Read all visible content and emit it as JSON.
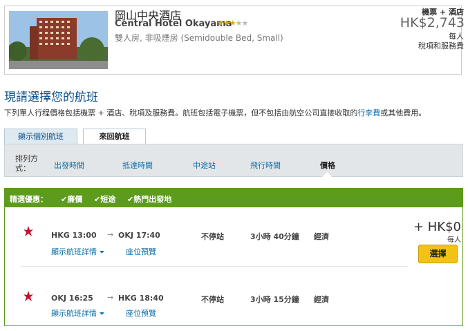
{
  "hotel": {
    "name_cn": "岡山中央酒店",
    "name_en": "Central Hotel Okayama",
    "stars": 3,
    "room_type": "雙人房, 非吸煙房 (Semidouble Bed, Small)",
    "package_label": "機票 + 酒店",
    "price": "HK$2,743",
    "per_person": "每人",
    "tax_note": "稅項和服務費"
  },
  "section": {
    "title": "現請選擇您的航班",
    "intro_before": "下列單人行程價格包括機票 + 酒店、稅項及服務費。航班包括電子機票，但不包括由航空公司直接收取的",
    "intro_link": "行李費",
    "intro_after": "或其他費用。"
  },
  "tabs": [
    "顯示個別航班",
    "來回航班"
  ],
  "sort": {
    "label": "排列方式：",
    "items": [
      "出發時間",
      "抵達時間",
      "中途站",
      "飛行時間",
      "價格"
    ],
    "active": "價格"
  },
  "promo": {
    "label": "精選優惠：",
    "tags": [
      "廉價",
      "短途",
      "熱門出發地"
    ]
  },
  "flights": [
    {
      "depart": "HKG 13:00",
      "arrive": "OKJ 17:40",
      "stops": "不停站",
      "duration": "3小時 40分鐘",
      "cabin": "經濟",
      "details_link": "顯示航班詳情",
      "seat_link": "座位預覽"
    },
    {
      "depart": "OKJ 16:25",
      "arrive": "HKG 18:40",
      "stops": "不停站",
      "duration": "3小時 15分鐘",
      "cabin": "經濟",
      "details_link": "顯示航班詳情",
      "seat_link": "座位預覽"
    }
  ],
  "offer": {
    "price_add": "+ HK$0",
    "per_person": "每人",
    "select_label": "選擇"
  },
  "colors": {
    "link": "#0a6fa8",
    "title": "#0a4f8a",
    "promo_green": "#5c9b1b",
    "select_yellow": "#f2c314",
    "airline_red": "#c8102e"
  }
}
